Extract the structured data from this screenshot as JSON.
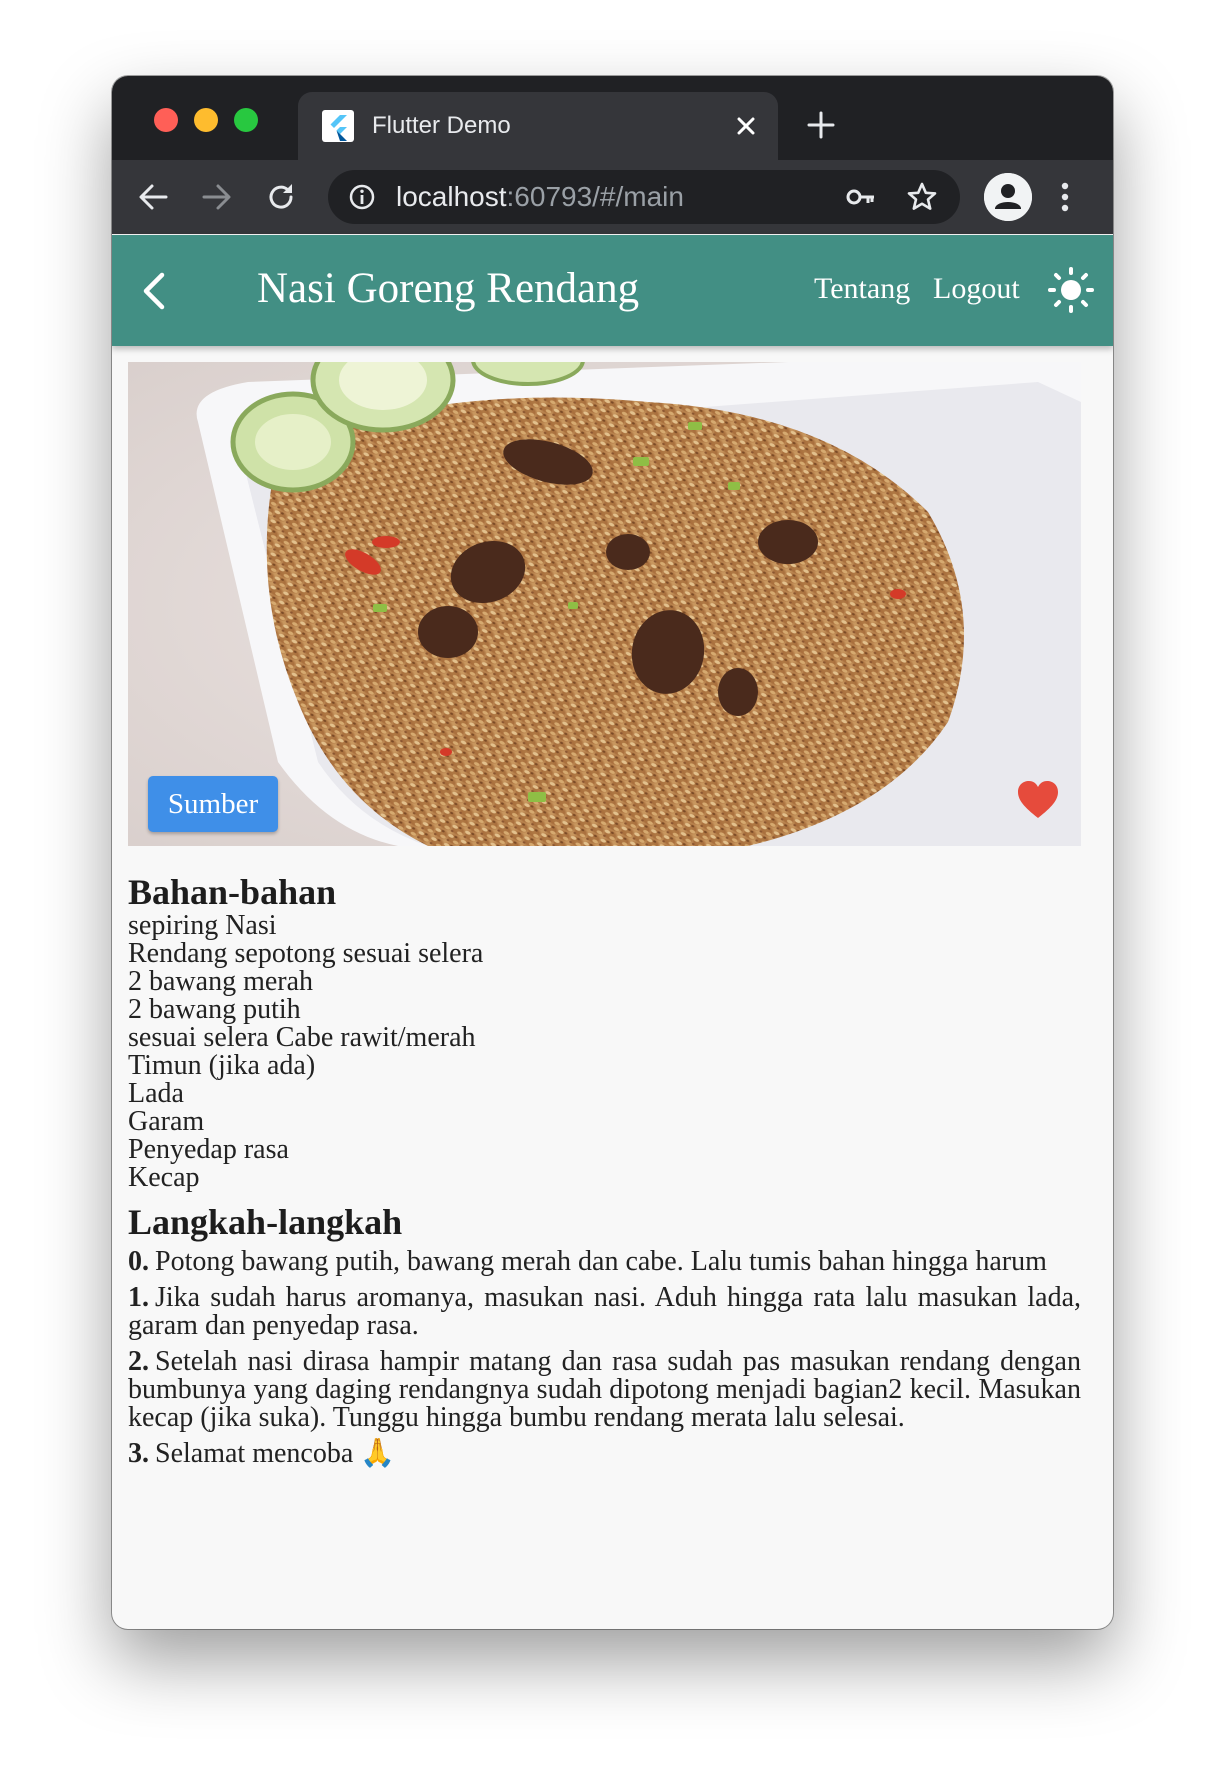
{
  "browser": {
    "tab_title": "Flutter Demo",
    "url_host": "localhost",
    "url_rest": ":60793/#/main"
  },
  "appbar": {
    "title": "Nasi Goreng Rendang",
    "actions": [
      "Tentang",
      "Logout"
    ]
  },
  "hero": {
    "source_button": "Sumber",
    "favorite_color": "#e64b3c"
  },
  "ingredients": {
    "heading": "Bahan-bahan",
    "items": [
      "sepiring Nasi",
      "Rendang sepotong sesuai selera",
      "2 bawang merah",
      "2 bawang putih",
      "sesuai selera Cabe rawit/merah",
      "Timun (jika ada)",
      "Lada",
      "Garam",
      "Penyedap rasa",
      "Kecap"
    ]
  },
  "steps": {
    "heading": "Langkah-langkah",
    "items": [
      {
        "number": "0.",
        "text": "Potong bawang putih, bawang merah dan cabe. Lalu tumis bahan hingga harum"
      },
      {
        "number": "1.",
        "text": "Jika sudah harus aromanya, masukan nasi. Aduh hingga rata lalu masukan lada, garam dan penyedap rasa."
      },
      {
        "number": "2.",
        "text": "Setelah nasi dirasa hampir matang dan rasa sudah pas masukan rendang dengan bumbunya yang daging rendangnya sudah dipotong menjadi bagian2 kecil. Masukan kecap (jika suka). Tunggu hingga bumbu rendang merata lalu selesai."
      },
      {
        "number": "3.",
        "text": "Selamat mencoba 🙏"
      }
    ]
  },
  "colors": {
    "appbar": "#428f84",
    "source_button": "#3f8fe8",
    "chrome_dark": "#202124",
    "chrome_mid": "#35363a"
  }
}
